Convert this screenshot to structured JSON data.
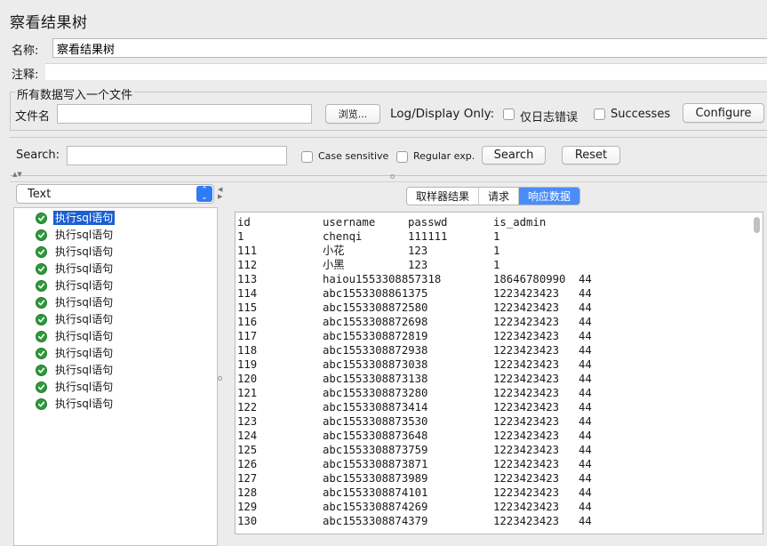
{
  "window": {
    "title": "察看结果树"
  },
  "name_row": {
    "label": "名称:",
    "value": "察看结果树"
  },
  "comment_row": {
    "label": "注释:",
    "value": ""
  },
  "file_group": {
    "title": "所有数据写入一个文件",
    "filename_label": "文件名",
    "filename_value": "",
    "browse_label": "浏览...",
    "log_display_label": "Log/Display Only:",
    "errors_only_label": "仅日志错误",
    "successes_label": "Successes",
    "configure_label": "Configure"
  },
  "search_bar": {
    "label": "Search:",
    "value": "",
    "case_sensitive_label": "Case sensitive",
    "regex_label": "Regular exp.",
    "search_button": "Search",
    "reset_button": "Reset"
  },
  "renderer": {
    "selected": "Text"
  },
  "tree": {
    "items": [
      {
        "label": "执行sql语句",
        "status": "success",
        "selected": true
      },
      {
        "label": "执行sql语句",
        "status": "success"
      },
      {
        "label": "执行sql语句",
        "status": "success"
      },
      {
        "label": "执行sql语句",
        "status": "success"
      },
      {
        "label": "执行sql语句",
        "status": "success"
      },
      {
        "label": "执行sql语句",
        "status": "success"
      },
      {
        "label": "执行sql语句",
        "status": "success"
      },
      {
        "label": "执行sql语句",
        "status": "success"
      },
      {
        "label": "执行sql语句",
        "status": "success"
      },
      {
        "label": "执行sql语句",
        "status": "success"
      },
      {
        "label": "执行sql语句",
        "status": "success"
      },
      {
        "label": "执行sql语句",
        "status": "success"
      }
    ]
  },
  "tabs": [
    {
      "label": "取样器结果",
      "active": false
    },
    {
      "label": "请求",
      "active": false
    },
    {
      "label": "响应数据",
      "active": true
    }
  ],
  "response": {
    "columns": [
      "id",
      "username",
      "passwd",
      "is_admin"
    ],
    "rows": [
      [
        "1",
        "chenqi",
        "111111",
        "1",
        ""
      ],
      [
        "111",
        "小花",
        "123",
        "1",
        ""
      ],
      [
        "112",
        "小黑",
        "123",
        "1",
        ""
      ],
      [
        "113",
        "haiou1553308857318",
        "",
        "18646780990",
        "44"
      ],
      [
        "114",
        "abc1553308861375",
        "",
        "1223423423",
        "44"
      ],
      [
        "115",
        "abc1553308872580",
        "",
        "1223423423",
        "44"
      ],
      [
        "116",
        "abc1553308872698",
        "",
        "1223423423",
        "44"
      ],
      [
        "117",
        "abc1553308872819",
        "",
        "1223423423",
        "44"
      ],
      [
        "118",
        "abc1553308872938",
        "",
        "1223423423",
        "44"
      ],
      [
        "119",
        "abc1553308873038",
        "",
        "1223423423",
        "44"
      ],
      [
        "120",
        "abc1553308873138",
        "",
        "1223423423",
        "44"
      ],
      [
        "121",
        "abc1553308873280",
        "",
        "1223423423",
        "44"
      ],
      [
        "122",
        "abc1553308873414",
        "",
        "1223423423",
        "44"
      ],
      [
        "123",
        "abc1553308873530",
        "",
        "1223423423",
        "44"
      ],
      [
        "124",
        "abc1553308873648",
        "",
        "1223423423",
        "44"
      ],
      [
        "125",
        "abc1553308873759",
        "",
        "1223423423",
        "44"
      ],
      [
        "126",
        "abc1553308873871",
        "",
        "1223423423",
        "44"
      ],
      [
        "127",
        "abc1553308873989",
        "",
        "1223423423",
        "44"
      ],
      [
        "128",
        "abc1553308874101",
        "",
        "1223423423",
        "44"
      ],
      [
        "129",
        "abc1553308874269",
        "",
        "1223423423",
        "44"
      ],
      [
        "130",
        "abc1553308874379",
        "",
        "1223423423",
        "44"
      ]
    ]
  },
  "colors": {
    "selection": "#1b5fd1",
    "active_tab": "#4a8df7",
    "success": "#2e9a3a"
  }
}
